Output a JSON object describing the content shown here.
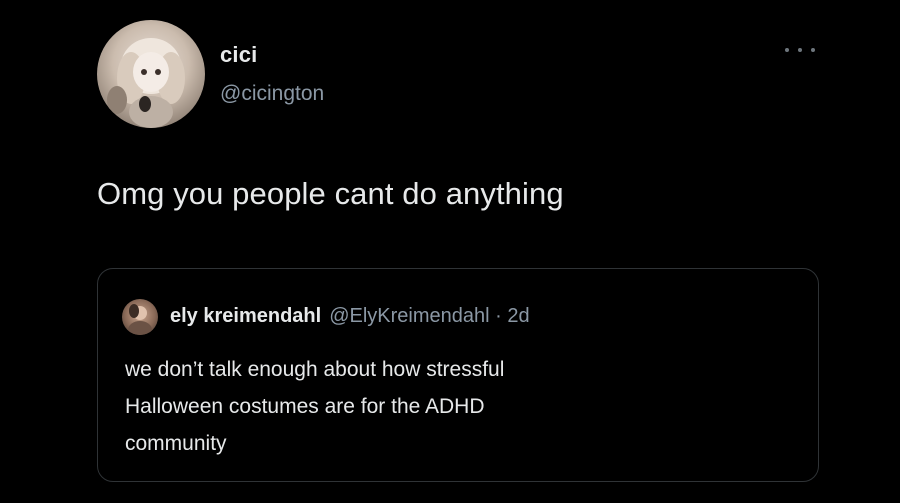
{
  "tweet": {
    "display_name": "cici",
    "handle": "@cicington",
    "text": "Omg you people cant do anything",
    "more_icon": "more-horizontal-icon",
    "avatar": "doll-avatar"
  },
  "quote": {
    "display_name": "ely kreimendahl",
    "handle": "@ElyKreimendahl",
    "separator": "·",
    "time": "2d",
    "text_lines": [
      "we don’t talk enough about how stressful",
      "Halloween costumes are for the ADHD",
      "community"
    ],
    "avatar": "person-avatar"
  },
  "colors": {
    "background": "#000000",
    "primary_text": "#e7e9ea",
    "secondary_text": "#8b98a5",
    "border": "#2f3336"
  }
}
